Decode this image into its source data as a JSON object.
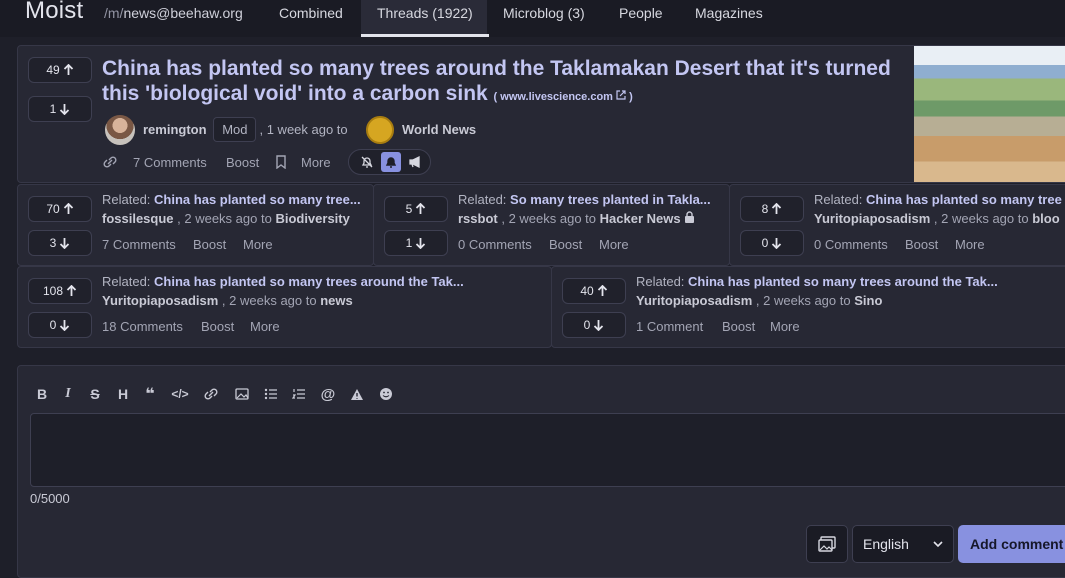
{
  "header": {
    "brand": "Moist",
    "crumb_prefix": "/m/",
    "crumb_name": "news@beehaw.org",
    "tabs": [
      "Combined",
      "Threads (1922)",
      "Microblog (3)",
      "People",
      "Magazines"
    ]
  },
  "main": {
    "up": "49",
    "down": "1",
    "title": "China has planted so many trees around the Taklamakan Desert that it's turned this 'biological void' into a carbon sink",
    "domain": "( www.livescience.com ",
    "domain_close": ")",
    "author": "remington",
    "mod": "Mod",
    "when": ", 1 week ago to",
    "magazine": "World News",
    "comments": "7 Comments",
    "boost": "Boost",
    "more": "More"
  },
  "related": [
    {
      "up": "70",
      "down": "3",
      "prefix": "Related: ",
      "title": "China has planted so many tree...",
      "author": "fossilesque",
      "when": " , 2 weeks ago to ",
      "magazine": "Biodiversity",
      "comments": "7 Comments",
      "boost": "Boost",
      "more": "More"
    },
    {
      "up": "5",
      "down": "1",
      "prefix": "Related: ",
      "title": "So many trees planted in Takla...",
      "author": "rssbot",
      "when": " , 2 weeks ago to ",
      "magazine": "Hacker News",
      "comments": "0 Comments",
      "boost": "Boost",
      "more": "More"
    },
    {
      "up": "8",
      "down": "0",
      "prefix": "Related: ",
      "title": "China has planted so many tree",
      "author": "Yuritopiaposadism",
      "when": " , 2 weeks ago to ",
      "magazine": "bloo",
      "comments": "0 Comments",
      "boost": "Boost",
      "more": "More"
    },
    {
      "up": "108",
      "down": "0",
      "prefix": "Related: ",
      "title": "China has planted so many trees around the Tak...",
      "author": "Yuritopiaposadism",
      "when": " , 2 weeks ago to ",
      "magazine": "news",
      "comments": "18 Comments",
      "boost": "Boost",
      "more": "More"
    },
    {
      "up": "40",
      "down": "0",
      "prefix": "Related: ",
      "title": "China has planted so many trees around the Tak...",
      "author": "Yuritopiaposadism",
      "when": " , 2 weeks ago to ",
      "magazine": "Sino",
      "comments": "1 Comment",
      "boost": "Boost",
      "more": "More"
    }
  ],
  "editor": {
    "toolbar_icons": [
      "bold-icon",
      "italic-icon",
      "strikethrough-icon",
      "heading-icon",
      "quote-icon",
      "code-icon",
      "link-icon",
      "image-icon",
      "bullet-list-icon",
      "numbered-list-icon",
      "mention-icon",
      "spoiler-icon",
      "emoji-icon"
    ],
    "counter": "0/5000",
    "language": "English",
    "submit": "Add comment"
  }
}
